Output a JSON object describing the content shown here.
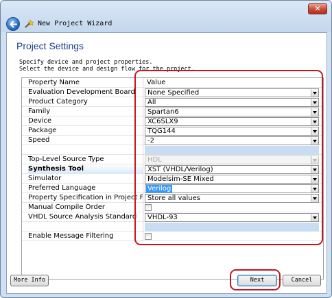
{
  "window": {
    "title": "New Project Wizard",
    "close_label": "✕"
  },
  "page": {
    "heading": "Project Settings",
    "description_line1": "Specify device and project properties.",
    "description_line2": "Select the device and design flow for the project."
  },
  "table": {
    "header_name": "Property Name",
    "header_value": "Value",
    "rows": [
      {
        "name": "Evaluation Development Board",
        "value": "None Specified"
      },
      {
        "name": "Product Category",
        "value": "All"
      },
      {
        "name": "Family",
        "value": "Spartan6"
      },
      {
        "name": "Device",
        "value": "XC6SLX9"
      },
      {
        "name": "Package",
        "value": "TQG144"
      },
      {
        "name": "Speed",
        "value": "-2"
      },
      {
        "name": "",
        "value": ""
      },
      {
        "name": "Top-Level Source Type",
        "value": "HDL"
      },
      {
        "name": "Synthesis Tool",
        "value": "XST (VHDL/Verilog)"
      },
      {
        "name": "Simulator",
        "value": "Modelsim-SE Mixed"
      },
      {
        "name": "Preferred Language",
        "value": "Verilog"
      },
      {
        "name": "Property Specification in Project File",
        "value": "Store all values"
      },
      {
        "name": "Manual Compile Order",
        "value": ""
      },
      {
        "name": "VHDL Source Analysis Standard",
        "value": "VHDL-93"
      },
      {
        "name": "",
        "value": ""
      },
      {
        "name": "Enable Message Filtering",
        "value": ""
      }
    ]
  },
  "buttons": {
    "more_info": "More Info",
    "next": "Next",
    "cancel": "Cancel"
  },
  "colors": {
    "annotation": "#c8141e",
    "heading": "#1a3f8a",
    "selection": "#3399ff"
  }
}
